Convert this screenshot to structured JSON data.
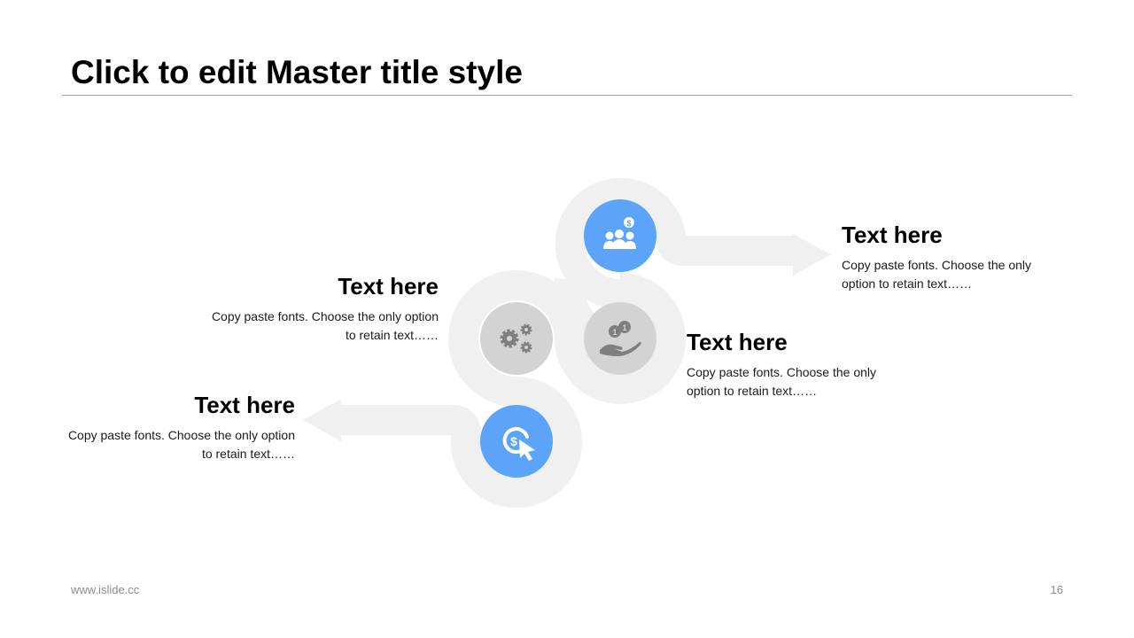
{
  "slide": {
    "title": "Click to edit Master title style",
    "footer_text": "www.islide.cc",
    "page_number": "16"
  },
  "colors": {
    "accent_blue": "#5ba4fa",
    "neutral_gray": "#d3d3d3",
    "icon_gray": "#7f7f7f",
    "path_gray": "#f0f0f0"
  },
  "items": [
    {
      "icon": "people-dollar-icon",
      "heading": "Text here",
      "body": "Copy paste fonts. Choose the only option to retain text……"
    },
    {
      "icon": "gears-icon",
      "heading": "Text here",
      "body": "Copy paste fonts. Choose the only option to retain text……"
    },
    {
      "icon": "hand-coins-icon",
      "heading": "Text here",
      "body": "Copy paste fonts. Choose the only option to retain text……"
    },
    {
      "icon": "dollar-click-icon",
      "heading": "Text here",
      "body": "Copy paste fonts. Choose the only option to retain text……"
    }
  ]
}
